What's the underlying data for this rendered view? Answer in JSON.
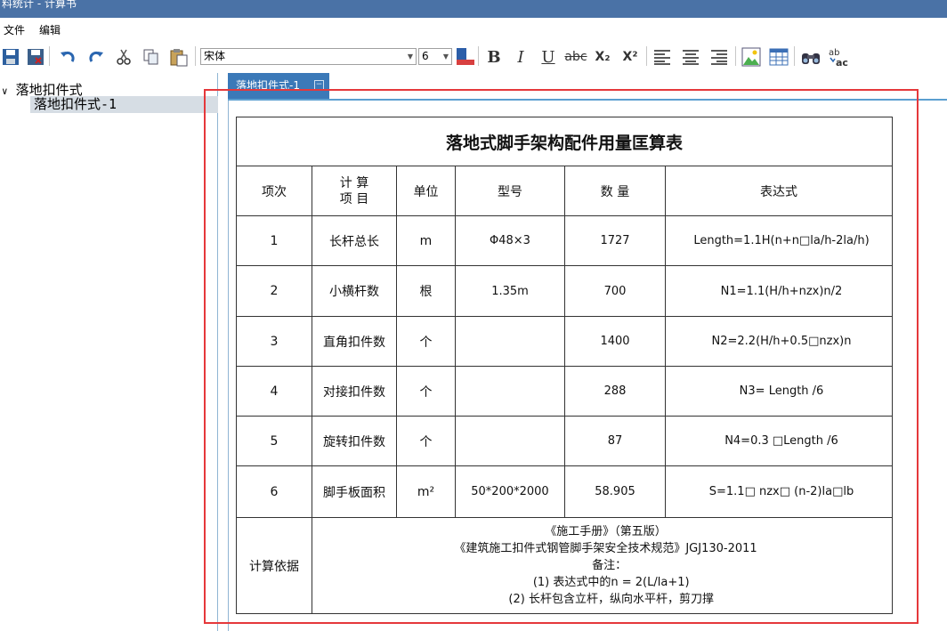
{
  "window": {
    "title": "料统计 - 计算书"
  },
  "menu": {
    "file": "文件",
    "edit": "编辑"
  },
  "toolbar": {
    "font_name": "宋体",
    "font_size": "6",
    "icons": [
      "save-icon",
      "save-all-icon",
      "undo-icon",
      "redo-icon",
      "cut-icon",
      "copy-icon",
      "paste-icon",
      "font-color-icon",
      "bold-icon",
      "italic-icon",
      "underline-icon",
      "strikethrough-icon",
      "subscript-icon",
      "superscript-icon",
      "align-left-icon",
      "align-center-icon",
      "align-right-icon",
      "insert-image-icon",
      "insert-table-icon",
      "find-icon",
      "replace-icon"
    ],
    "bold": "B",
    "italic": "I",
    "underline": "U",
    "strike": "abc",
    "sub": "X₂",
    "sup": "X²"
  },
  "tree": {
    "root": "落地扣件式",
    "child": "落地扣件式-1",
    "root_toggle": "∨"
  },
  "tab": {
    "label": "落地扣件式-1"
  },
  "table": {
    "title": "落地式脚手架构配件用量匡算表",
    "headers": [
      "项次",
      "计 算\n项 目",
      "单位",
      "型号",
      "数 量",
      "表达式"
    ],
    "rows": [
      [
        "1",
        "长杆总长",
        "m",
        "Φ48×3",
        "1727",
        "Length=1.1H(n+n□la/h-2la/h)"
      ],
      [
        "2",
        "小横杆数",
        "根",
        "1.35m",
        "700",
        "N1=1.1(H/h+nzx)n/2"
      ],
      [
        "3",
        "直角扣件数",
        "个",
        "",
        "1400",
        "N2=2.2(H/h+0.5□nzx)n"
      ],
      [
        "4",
        "对接扣件数",
        "个",
        "",
        "288",
        "N3= Length /6"
      ],
      [
        "5",
        "旋转扣件数",
        "个",
        "",
        "87",
        "N4=0.3 □Length /6"
      ],
      [
        "6",
        "脚手板面积",
        "m²",
        "50*200*2000",
        "58.905",
        "S=1.1□ nzx□ (n-2)la□lb"
      ]
    ],
    "basis_label": "计算依据",
    "basis_lines": [
      "《施工手册》（第五版）",
      "《建筑施工扣件式钢管脚手架安全技术规范》JGJ130-2011",
      "  备注：",
      "   (1) 表达式中的n = 2(L/la+1)",
      "   (2) 长杆包含立杆，纵向水平杆，剪刀撑"
    ]
  }
}
